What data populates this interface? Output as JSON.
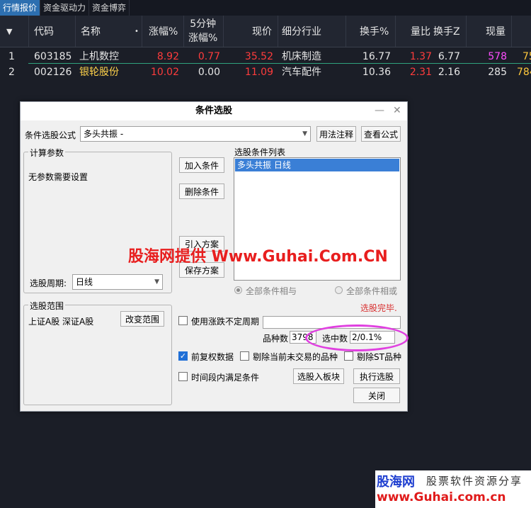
{
  "tabs": [
    "行情报价",
    "资金驱动力",
    "资金博弈"
  ],
  "table": {
    "menu_icon": "dropdown-triangle-icon",
    "headers": {
      "code": "代码",
      "name": "名称",
      "name_dot": "•",
      "change_pct": "涨幅%",
      "five_min_1": "5分钟",
      "five_min_2": "涨幅%",
      "price": "现价",
      "industry": "细分行业",
      "turnover": "换手%",
      "volume_ratio": "量比",
      "turnover_z": "换手Z",
      "volume": "现量"
    },
    "rows": [
      {
        "index": "1",
        "code": "603185",
        "name": "上机数控",
        "change_pct": "8.92",
        "five_min": "0.77",
        "price": "35.52",
        "industry": "机床制造",
        "turnover": "16.77",
        "volume_ratio": "1.37",
        "turnover_z": "6.77",
        "volume": "578",
        "extra": "75"
      },
      {
        "index": "2",
        "code": "002126",
        "name": "银轮股份",
        "change_pct": "10.02",
        "five_min": "0.00",
        "price": "11.09",
        "industry": "汽车配件",
        "turnover": "10.36",
        "volume_ratio": "2.31",
        "turnover_z": "2.16",
        "volume": "285",
        "extra": "784"
      }
    ]
  },
  "dialog": {
    "title": "条件选股",
    "minimize": "—",
    "close": "✕",
    "formula_label": "条件选股公式",
    "formula_value": "多头共振      -",
    "usage_btn": "用法注释",
    "view_formula_btn": "查看公式",
    "calc_params_title": "计算参数",
    "no_params": "无参数需要设置",
    "period_label": "选股周期:",
    "period_value": "日线",
    "range_title": "选股范围",
    "range_value": "上证A股 深证A股",
    "change_range_btn": "改变范围",
    "add_cond_btn": "加入条件",
    "del_cond_btn": "删除条件",
    "import_plan_btn": "引入方案",
    "save_plan_btn": "保存方案",
    "cond_list_title": "选股条件列表",
    "cond_items": [
      "多头共振  日线"
    ],
    "radio_and": "全部条件相与",
    "radio_or": "全部条件相或",
    "status": "选股完毕.",
    "use_period": "使用涨跌不定周期",
    "count_label": "品种数",
    "count_value": "3798",
    "selected_label": "选中数",
    "selected_value": "2/0.1%",
    "adj_data": "前复权数据",
    "exclude_untraded": "剔除当前未交易的品种",
    "exclude_st": "剔除ST品种",
    "period_satisfy": "时间段内满足条件",
    "to_block_btn": "选股入板块",
    "execute_btn": "执行选股",
    "close_btn": "关闭"
  },
  "watermark": "股海网提供 Www.Guhai.Com.CN",
  "logo": {
    "brand": "股海网",
    "slogan": "股票软件资源分享",
    "url": "www.Guhai.com.cn"
  },
  "colors": {
    "up_red": "#ff3c3c",
    "accent_blue": "#2d6fb0",
    "highlight_magenta": "#e040e0"
  }
}
